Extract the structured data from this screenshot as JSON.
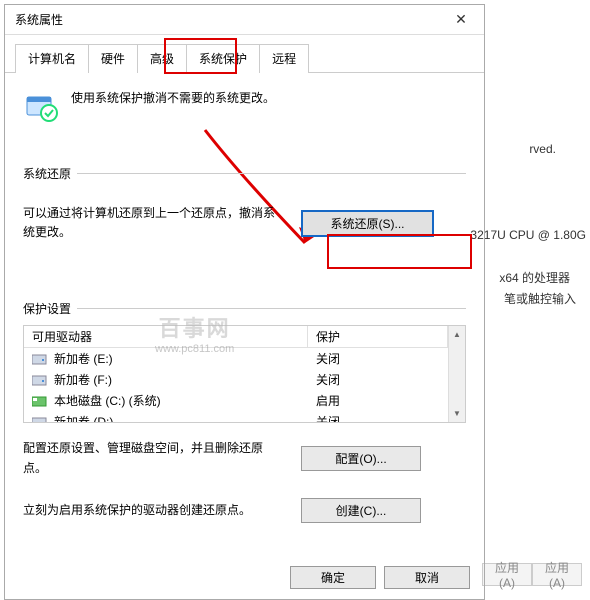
{
  "title": "系统属性",
  "tabs": [
    "计算机名",
    "硬件",
    "高级",
    "系统保护",
    "远程"
  ],
  "active_tab_index": 3,
  "intro_text": "使用系统保护撤消不需要的系统更改。",
  "sections": {
    "restore": {
      "label": "系统还原",
      "text": "可以通过将计算机还原到上一个还原点，撤消系统更改。",
      "button": "系统还原(S)..."
    },
    "protection": {
      "label": "保护设置",
      "columns": {
        "drive": "可用驱动器",
        "protect": "保护"
      },
      "rows": [
        {
          "name": "新加卷 (E:)",
          "protect": "关闭",
          "icon": "hdd"
        },
        {
          "name": "新加卷 (F:)",
          "protect": "关闭",
          "icon": "hdd"
        },
        {
          "name": "本地磁盘 (C:) (系统)",
          "protect": "启用",
          "icon": "sys"
        },
        {
          "name": "新加卷 (D:)",
          "protect": "关闭",
          "icon": "hdd"
        }
      ],
      "config_text": "配置还原设置、管理磁盘空间，并且删除还原点。",
      "config_button": "配置(O)...",
      "create_text": "立刻为启用系统保护的驱动器创建还原点。",
      "create_button": "创建(C)..."
    }
  },
  "buttons": {
    "ok": "确定",
    "cancel": "取消",
    "apply": "应用(A)"
  },
  "watermark": {
    "line1": "百事网",
    "line2": "www.pc811.com"
  },
  "background": {
    "rights": "rved.",
    "cpu": "3217U CPU @ 1.80G",
    "arch": "x64 的处理器",
    "input": "笔或触控输入",
    "apply2": "应用(A)"
  },
  "colors": {
    "accent": "#1668c5",
    "annotation": "#d00"
  }
}
